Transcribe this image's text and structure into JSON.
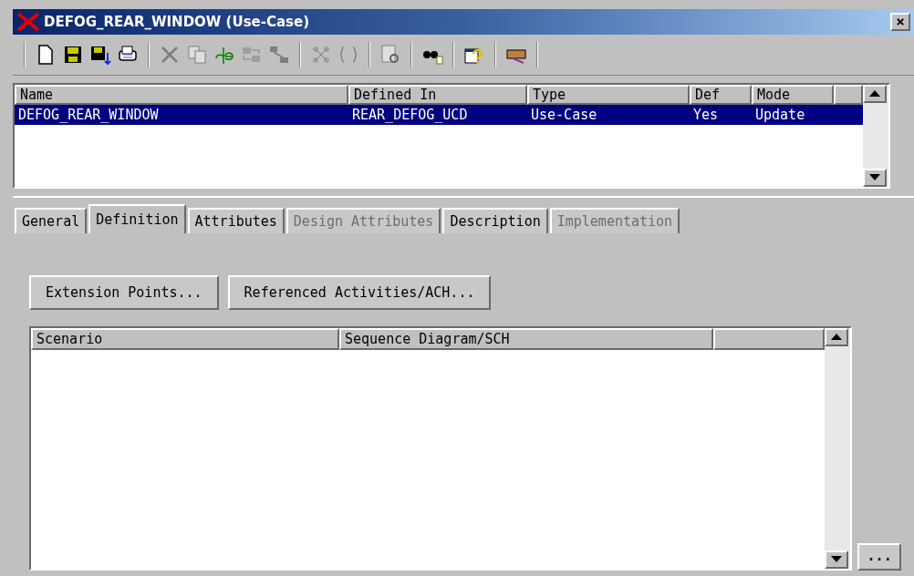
{
  "window": {
    "title": "DEFOG_REAR_WINDOW (Use-Case)",
    "close": "×"
  },
  "list": {
    "columns": [
      "Name",
      "Defined In",
      "Type",
      "Def",
      "Mode"
    ],
    "rows": [
      {
        "cells": [
          "DEFOG_REAR_WINDOW",
          "REAR_DEFOG_UCD",
          "Use-Case",
          "Yes",
          "Update"
        ],
        "selected": true
      }
    ]
  },
  "tabs": [
    {
      "label": "General",
      "selected": false,
      "disabled": false
    },
    {
      "label": "Definition",
      "selected": true,
      "disabled": false
    },
    {
      "label": "Attributes",
      "selected": false,
      "disabled": false
    },
    {
      "label": "Design Attributes",
      "selected": false,
      "disabled": true
    },
    {
      "label": "Description",
      "selected": false,
      "disabled": false
    },
    {
      "label": "Implementation",
      "selected": false,
      "disabled": true
    }
  ],
  "buttons": [
    "Extension Points...",
    "Referenced Activities/ACH..."
  ],
  "scenario_table": {
    "columns": [
      "Scenario",
      "Sequence Diagram/SCH"
    ]
  },
  "more_button": "..."
}
